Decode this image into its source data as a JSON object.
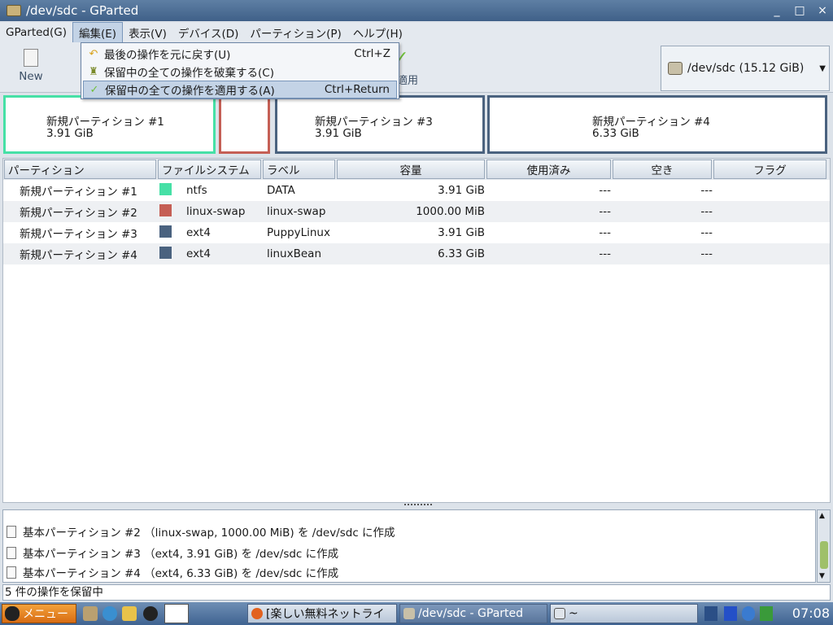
{
  "window": {
    "title": "/dev/sdc - GParted",
    "min": "_",
    "max": "□",
    "close": "×"
  },
  "menubar": [
    {
      "label": "GParted(G)"
    },
    {
      "label": "編集(E)"
    },
    {
      "label": "表示(V)"
    },
    {
      "label": "デバイス(D)"
    },
    {
      "label": "パーティション(P)"
    },
    {
      "label": "ヘルプ(H)"
    }
  ],
  "toolbar": {
    "new_label": "New",
    "apply_label": "適用"
  },
  "device_selector": {
    "label": "/dev/sdc  (15.12 GiB)"
  },
  "edit_menu": [
    {
      "label": "最後の操作を元に戻す(U)",
      "accel": "Ctrl+Z"
    },
    {
      "label": "保留中の全ての操作を破棄する(C)",
      "accel": ""
    },
    {
      "label": "保留中の全ての操作を適用する(A)",
      "accel": "Ctrl+Return"
    }
  ],
  "partition_map": [
    {
      "name": "新規パーティション #1",
      "size": "3.91 GiB",
      "color": "#46e0a6"
    },
    {
      "name": "",
      "size": "",
      "color": "#c55f55"
    },
    {
      "name": "新規パーティション #3",
      "size": "3.91 GiB",
      "color": "#4a627f"
    },
    {
      "name": "新規パーティション #4",
      "size": "6.33 GiB",
      "color": "#4a627f"
    }
  ],
  "table": {
    "headers": [
      "パーティション",
      "ファイルシステム",
      "ラベル",
      "容量",
      "使用済み",
      "空き",
      "フラグ"
    ],
    "rows": [
      {
        "partition": "新規パーティション #1",
        "fs": "ntfs",
        "color": "#46e0a6",
        "label": "DATA",
        "size": "3.91 GiB",
        "used": "---",
        "free": "---",
        "flags": ""
      },
      {
        "partition": "新規パーティション #2",
        "fs": "linux-swap",
        "color": "#c55f55",
        "label": "linux-swap",
        "size": "1000.00 MiB",
        "used": "---",
        "free": "---",
        "flags": ""
      },
      {
        "partition": "新規パーティション #3",
        "fs": "ext4",
        "color": "#4a627f",
        "label": "PuppyLinux",
        "size": "3.91 GiB",
        "used": "---",
        "free": "---",
        "flags": ""
      },
      {
        "partition": "新規パーティション #4",
        "fs": "ext4",
        "color": "#4a627f",
        "label": "linuxBean",
        "size": "6.33 GiB",
        "used": "---",
        "free": "---",
        "flags": ""
      }
    ]
  },
  "log": [
    "基本パーティション #2 （linux-swap, 1000.00 MiB) を /dev/sdc に作成",
    "基本パーティション #3 （ext4, 3.91 GiB) を /dev/sdc に作成",
    "基本パーティション #4 （ext4, 6.33 GiB) を /dev/sdc に作成"
  ],
  "status": "5 件の操作を保留中",
  "taskbar": {
    "menu_label": "メニュー",
    "tasks": [
      {
        "label": "[楽しい無料ネットライ"
      },
      {
        "label": "/dev/sdc - GParted"
      },
      {
        "label": "~"
      }
    ],
    "clock": "07:08"
  }
}
